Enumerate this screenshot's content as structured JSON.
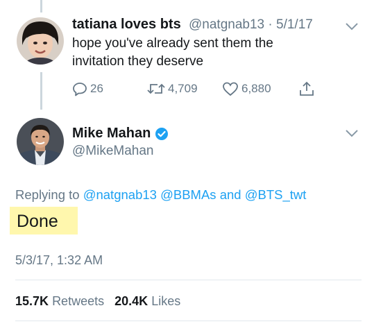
{
  "first_tweet": {
    "display_name": "tatiana loves bts",
    "handle": "@natgnab13",
    "separator": "·",
    "date": "5/1/17",
    "text_line1": "hope you've already sent them the",
    "text_line2": "invitation they deserve",
    "actions": {
      "reply_count": "26",
      "retweet_count": "4,709",
      "like_count": "6,880"
    }
  },
  "main_tweet": {
    "display_name": "Mike Mahan",
    "handle": "@MikeMahan",
    "verified": true,
    "replying_label": "Replying to",
    "reply_to_1": "@natgnab13",
    "reply_to_2": "@BBMAs",
    "reply_and": "and",
    "reply_to_3": "@BTS_twt",
    "text": "Done",
    "timestamp": "5/3/17, 1:32 AM",
    "retweets_count": "15.7K",
    "retweets_label": "Retweets",
    "likes_count": "20.4K",
    "likes_label": "Likes"
  },
  "colors": {
    "accent": "#1da1f2",
    "muted": "#657786",
    "highlight": "#fff7ad",
    "verified": "#1da1f2"
  }
}
